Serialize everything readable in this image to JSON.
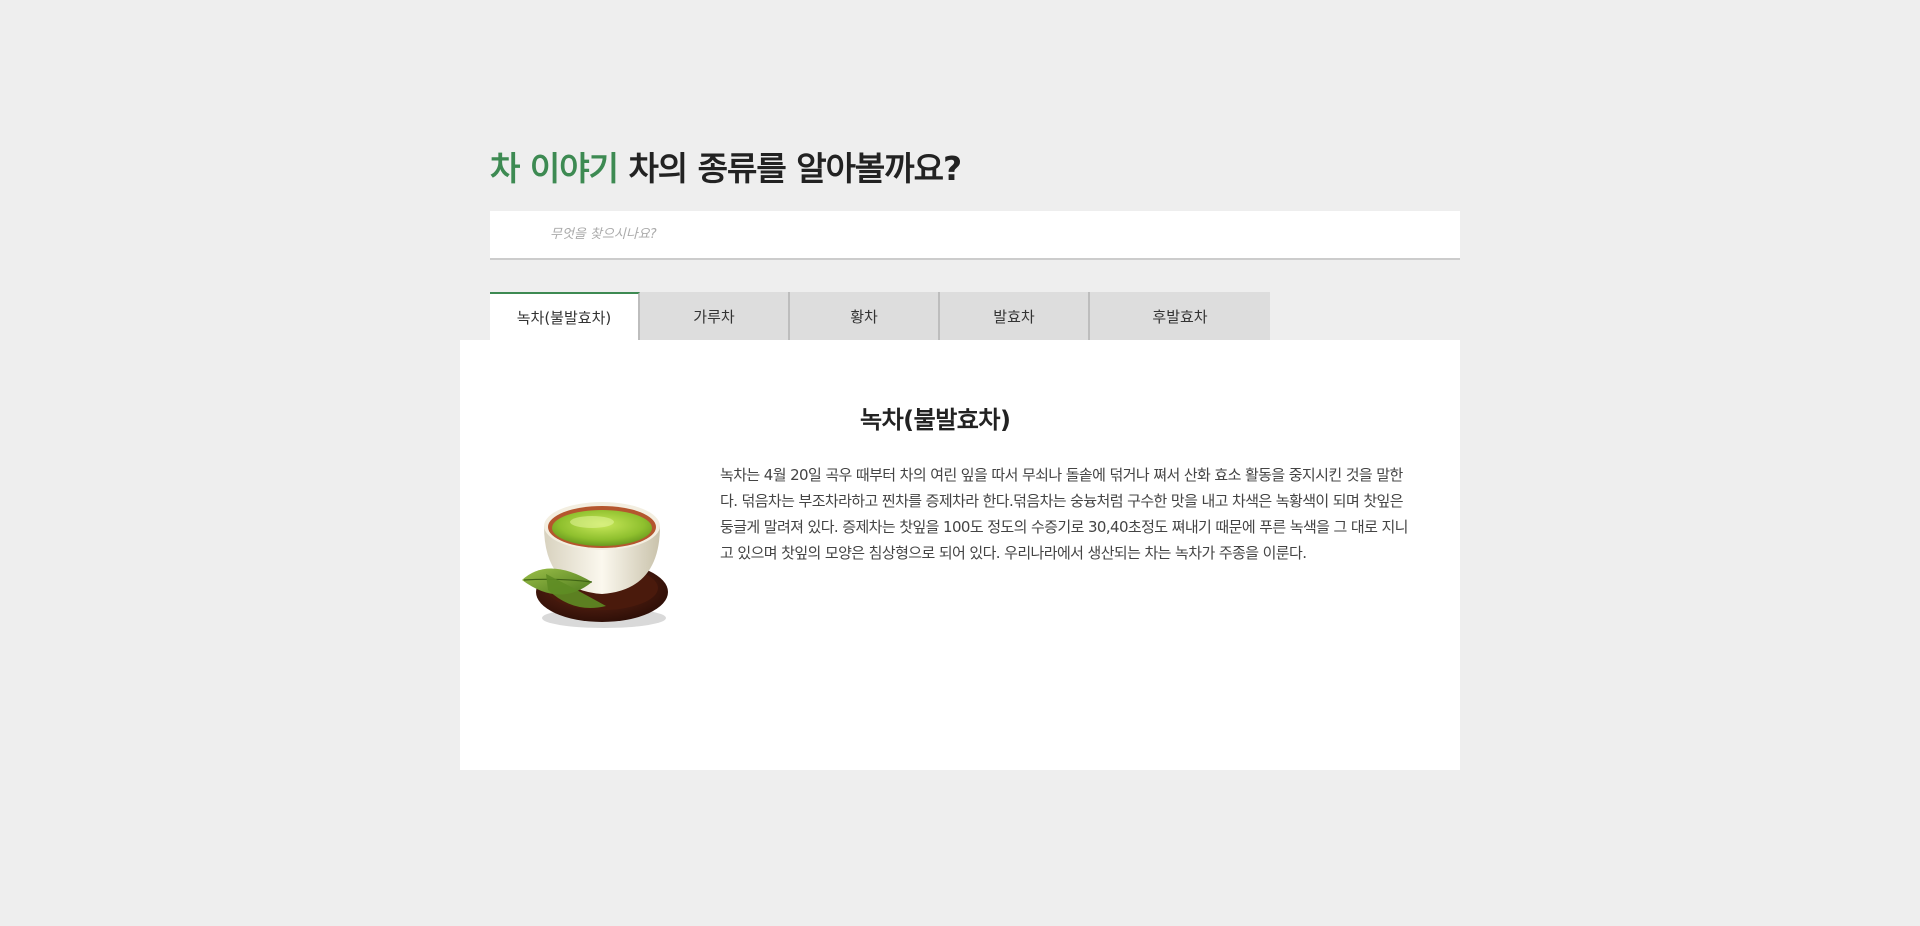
{
  "header": {
    "title_accent": "차 이야기",
    "title_rest": "차의 종류를 알아볼까요?"
  },
  "search": {
    "placeholder": "무엇을 찾으시나요?",
    "value": ""
  },
  "tabs": [
    {
      "label": "녹차(불발효차)",
      "active": true
    },
    {
      "label": "가루차",
      "active": false
    },
    {
      "label": "황차",
      "active": false
    },
    {
      "label": "발효차",
      "active": false
    },
    {
      "label": "후발효차",
      "active": false
    }
  ],
  "content": {
    "title": "녹차(불발효차)",
    "image_icon": "green-tea-cup-icon",
    "description": "녹차는 4월 20일 곡우 때부터 차의 여린 잎을 따서 무쇠나 돌솥에 덖거나 쪄서 산화 효소 활동을 중지시킨 것을 말한다. 덖음차는 부조차라하고 찐차를 증제차라 한다.덖음차는 숭늉처럼 구수한 맛을 내고 차색은 녹황색이 되며 찻잎은 둥글게 말려져 있다. 증제차는 찻잎을 100도 정도의 수증기로 30,40초정도 쪄내기 때문에 푸른 녹색을 그 대로 지니고 있으며 찻잎의 모양은 침상형으로 되어 있다. 우리나라에서 생산되는 차는 녹차가 주종을 이룬다."
  },
  "colors": {
    "accent": "#3d8a52",
    "background": "#eeeeee",
    "tab_inactive": "#dddddd",
    "panel": "#ffffff"
  }
}
